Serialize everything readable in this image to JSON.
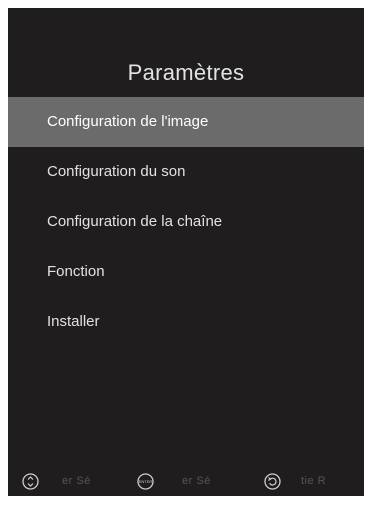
{
  "menu": {
    "title": "Paramètres",
    "items": [
      {
        "label": "Configuration de l'image",
        "selected": true
      },
      {
        "label": "Configuration du son",
        "selected": false
      },
      {
        "label": "Configuration de la chaîne",
        "selected": false
      },
      {
        "label": "Fonction",
        "selected": false
      },
      {
        "label": "Installer",
        "selected": false
      }
    ]
  },
  "footer": {
    "hints": [
      {
        "icon": "up-down-arrows-icon",
        "text": "er   Sé"
      },
      {
        "icon": "enter-button-icon",
        "icon_text": "ENTER",
        "text": "er   Sé"
      },
      {
        "icon": "return-icon",
        "text": "tie   R"
      }
    ]
  },
  "colors": {
    "background": "#1f1d1e",
    "selection": "#6b6b6b",
    "text": "#e2e2e2",
    "hint_text": "#565656"
  }
}
